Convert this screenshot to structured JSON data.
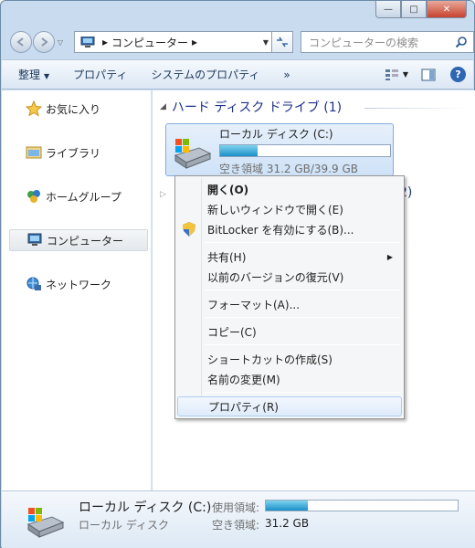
{
  "window": {
    "caption_minimize": "—",
    "caption_maximize": "□",
    "caption_close": "✕"
  },
  "address": {
    "crumb_arrow": "▸",
    "location": "コンピューター",
    "search_placeholder": "コンピューターの検索"
  },
  "toolbar": {
    "organize": "整理",
    "properties": "プロパティ",
    "system_properties": "システムのプロパティ",
    "more": "»",
    "help": "?"
  },
  "nav": {
    "items": [
      {
        "label": "お気に入り",
        "icon": "star-icon"
      },
      {
        "label": "ライブラリ",
        "icon": "library-icon"
      },
      {
        "label": "ホームグループ",
        "icon": "homegroup-icon"
      },
      {
        "label": "コンピューター",
        "icon": "computer-icon",
        "selected": true
      },
      {
        "label": "ネットワーク",
        "icon": "network-icon"
      }
    ]
  },
  "content": {
    "group_title": "ハード ディスク ドライブ (1)",
    "group2_count": "2)",
    "drive": {
      "name": "ローカル ディスク (C:)",
      "free_text": "空き領域 31.2 GB/39.9 GB",
      "used_fraction": 0.22
    }
  },
  "context_menu": {
    "open": "開く(O)",
    "open_new_window": "新しいウィンドウで開く(E)",
    "bitlocker": "BitLocker を有効にする(B)...",
    "share": "共有(H)",
    "restore_previous": "以前のバージョンの復元(V)",
    "format": "フォーマット(A)...",
    "copy": "コピー(C)",
    "create_shortcut": "ショートカットの作成(S)",
    "rename": "名前の変更(M)",
    "properties": "プロパティ(R)"
  },
  "status": {
    "title": "ローカル ディスク (C:)",
    "type": "ローカル ディスク",
    "used_label": "使用領域:",
    "free_label": "空き領域:",
    "free_value": "31.2 GB",
    "used_fraction": 0.22
  },
  "colors": {
    "accent": "#1c8fc6",
    "group_title": "#1e3287"
  }
}
